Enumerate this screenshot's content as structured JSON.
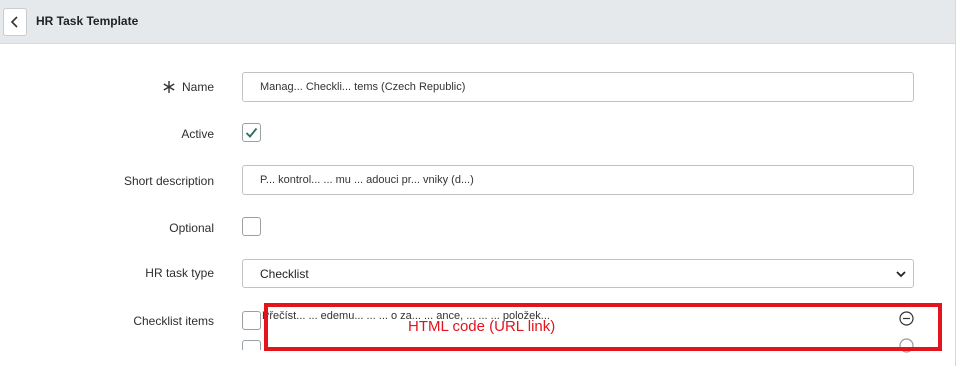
{
  "header": {
    "title": "HR Task Template",
    "back_icon": "chevron-left-icon"
  },
  "form": {
    "name": {
      "label": "Name",
      "required_icon": "required-asterisk-icon",
      "value": "Manag... Checkli... tems (Czech Republic)"
    },
    "active": {
      "label": "Active",
      "checked": true
    },
    "short_description": {
      "label": "Short description",
      "value": "P... kontrol... ... mu ... adouci pr... vniky (d...)"
    },
    "optional": {
      "label": "Optional",
      "checked": false
    },
    "hr_task_type": {
      "label": "HR task type",
      "selected": "Checklist",
      "icon": "chevron-down-icon"
    },
    "checklist_items": {
      "label": "Checklist items",
      "items": [
        {
          "text": "Přečíst... ... edemu... ... ... o za... ... ance, ... ... ... položek...",
          "checked": false,
          "remove_icon": "minus-circle-icon"
        },
        {
          "text": "",
          "checked": false,
          "remove_icon": "minus-circle-icon"
        }
      ]
    }
  },
  "annotation": {
    "text": "HTML code (URL link)",
    "color": "#e3141b"
  },
  "colors": {
    "header_bg": "#e6e9eb",
    "check_color": "#2f6b5a",
    "annotation_red": "#e3141b"
  }
}
